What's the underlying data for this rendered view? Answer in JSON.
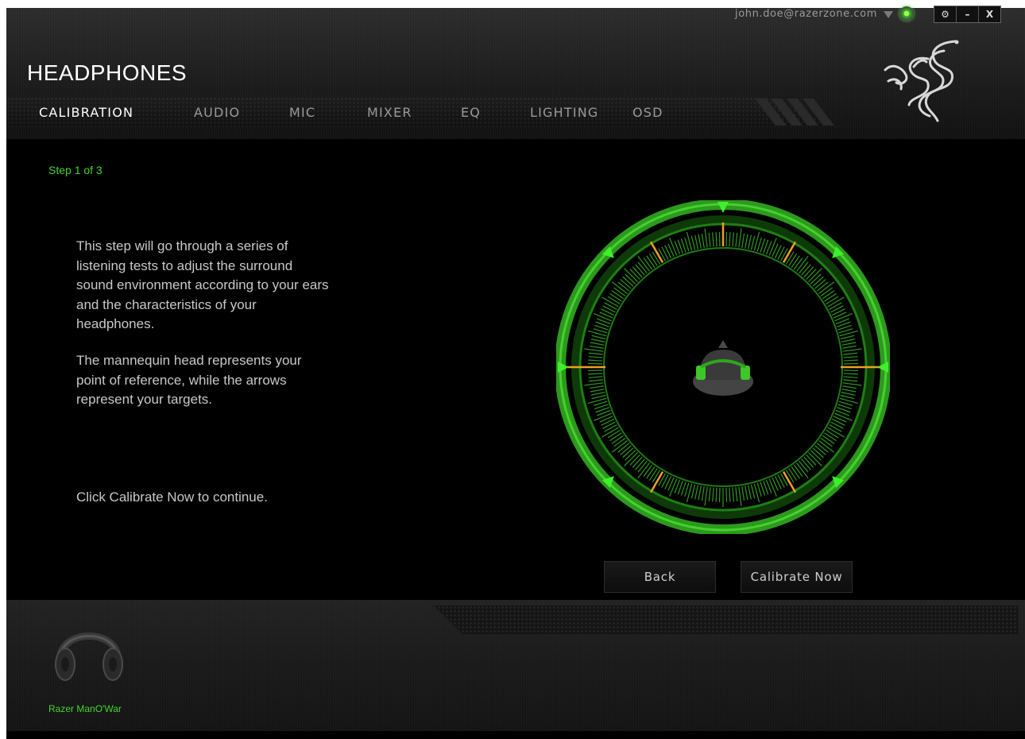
{
  "account": {
    "email": "john.doe@razerzone.com"
  },
  "window_controls": {
    "settings": "⚙",
    "minimize": "–",
    "close": "X"
  },
  "app": {
    "title": "HEADPHONES"
  },
  "tabs": [
    {
      "label": "CALIBRATION",
      "active": true
    },
    {
      "label": "AUDIO",
      "active": false
    },
    {
      "label": "MIC",
      "active": false
    },
    {
      "label": "MIXER",
      "active": false
    },
    {
      "label": "EQ",
      "active": false
    },
    {
      "label": "LIGHTING",
      "active": false
    },
    {
      "label": "OSD",
      "active": false
    }
  ],
  "calibration": {
    "step_label": "Step 1 of 3",
    "paragraph1": "This step will go through a series of listening tests to adjust the surround sound environment according to your ears and the characteristics of your headphones.",
    "paragraph2": "The mannequin head represents your point of reference, while the arrows represent your targets.",
    "paragraph3": "Click Calibrate Now to continue.",
    "back_label": "Back",
    "calibrate_label": "Calibrate Now"
  },
  "device": {
    "name": "Razer ManO'War"
  },
  "colors": {
    "accent_green": "#44d62c",
    "marker_orange": "#f0a020",
    "text_gray": "#c8c8c8"
  }
}
